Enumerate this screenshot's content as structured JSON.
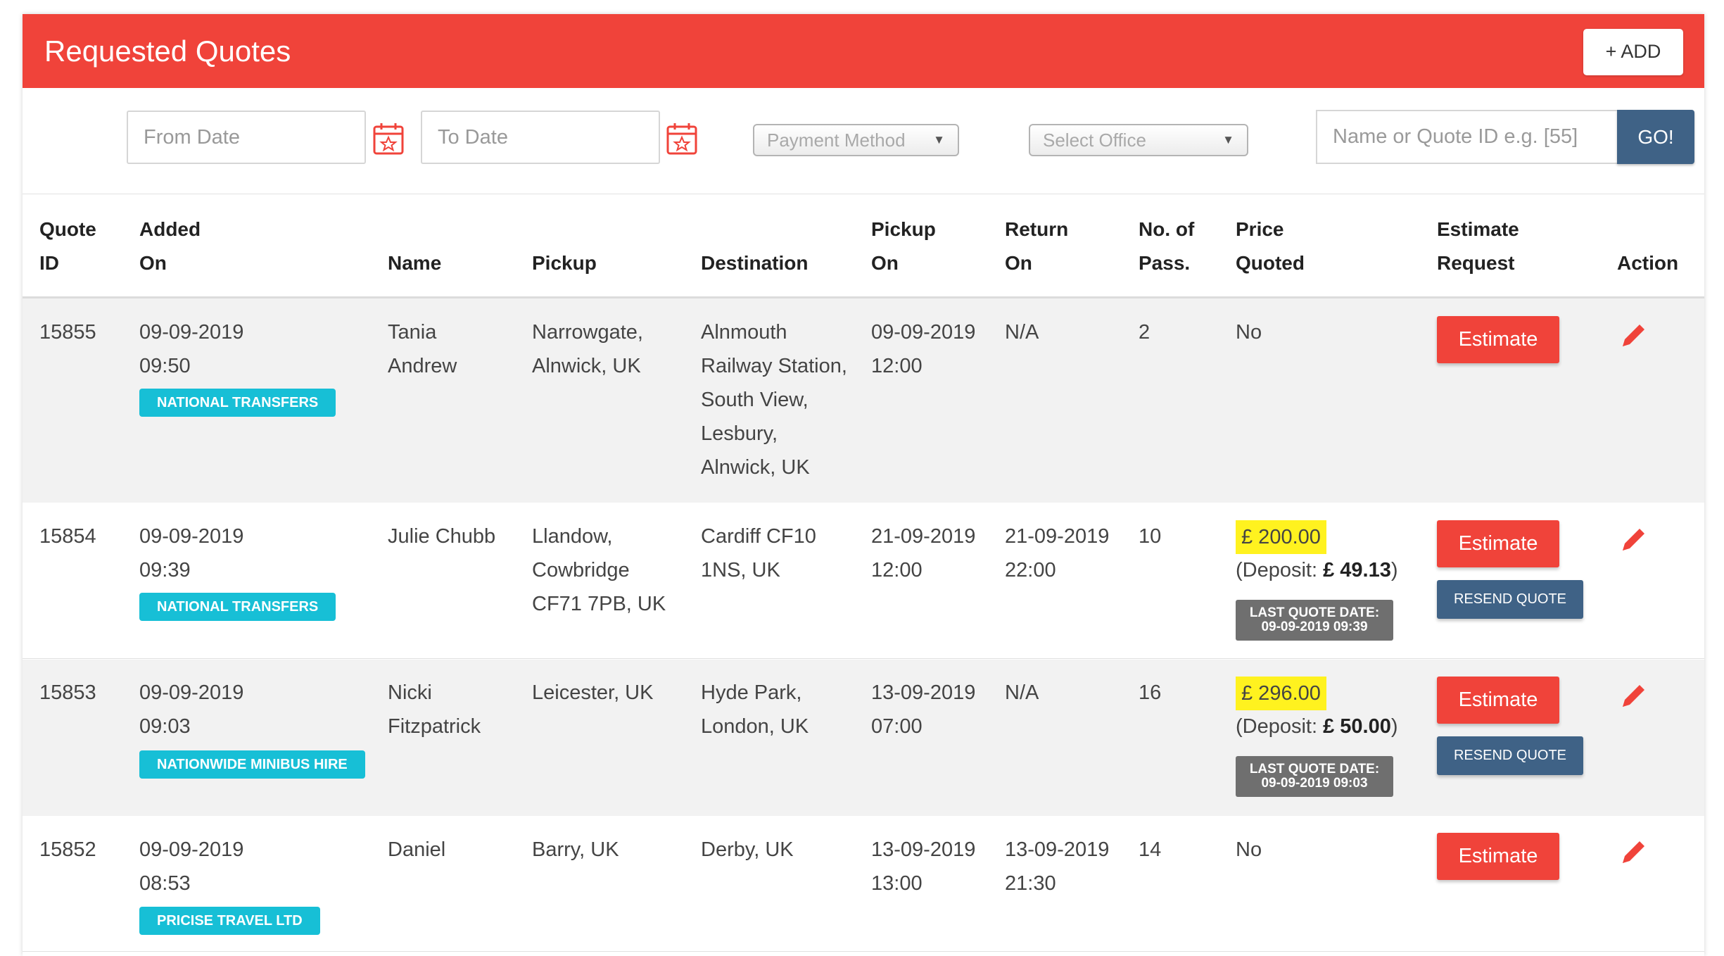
{
  "header": {
    "title": "Requested Quotes",
    "add_label": "+ ADD"
  },
  "filters": {
    "from_date_placeholder": "From Date",
    "to_date_placeholder": "To Date",
    "payment_method": "Payment Method",
    "office": "Select Office",
    "search_placeholder": "Name or Quote ID e.g. [55]",
    "go_label": "GO!"
  },
  "table": {
    "headers": {
      "quote_id": [
        "Quote",
        "ID"
      ],
      "added_on": [
        "Added",
        "On"
      ],
      "name": "Name",
      "pickup": "Pickup",
      "destination": "Destination",
      "pickup_on": [
        "Pickup",
        "On"
      ],
      "return_on": [
        "Return",
        "On"
      ],
      "passengers": [
        "No. of",
        "Pass."
      ],
      "price_quoted": [
        "Price",
        "Quoted"
      ],
      "estimate_request": [
        "Estimate",
        "Request"
      ],
      "action": "Action"
    },
    "rows": [
      {
        "id": "15855",
        "added": [
          "09-09-2019",
          "09:50"
        ],
        "tag": "NATIONAL TRANSFERS",
        "name": [
          "Tania",
          "Andrew"
        ],
        "pickup": [
          "Narrowgate,",
          "Alnwick, UK"
        ],
        "destination": [
          "Alnmouth",
          "Railway Station,",
          "South View,",
          "Lesbury,",
          "Alnwick, UK"
        ],
        "pickup_on": [
          "09-09-2019",
          "12:00"
        ],
        "return_on": [
          "N/A"
        ],
        "passengers": "2",
        "price": "No",
        "estimate_label": "Estimate"
      },
      {
        "id": "15854",
        "added": [
          "09-09-2019",
          "09:39"
        ],
        "tag": "NATIONAL TRANSFERS",
        "name": [
          "Julie Chubb"
        ],
        "pickup": [
          "Llandow,",
          "Cowbridge",
          "CF71 7PB, UK"
        ],
        "destination": [
          "Cardiff CF10",
          "1NS, UK"
        ],
        "pickup_on": [
          "21-09-2019",
          "12:00"
        ],
        "return_on": [
          "21-09-2019",
          "22:00"
        ],
        "passengers": "10",
        "price": "£ 200.00",
        "deposit_prefix": "(Deposit: ",
        "deposit_value": "£ 49.13",
        "deposit_suffix": ")",
        "last_quote_label": "LAST QUOTE DATE:",
        "last_quote_date": "09-09-2019 09:39",
        "estimate_label": "Estimate",
        "resend_label": "RESEND QUOTE"
      },
      {
        "id": "15853",
        "added": [
          "09-09-2019",
          "09:03"
        ],
        "tag": "NATIONWIDE MINIBUS HIRE",
        "name": [
          "Nicki",
          "Fitzpatrick"
        ],
        "pickup": [
          "Leicester, UK"
        ],
        "destination": [
          "Hyde Park,",
          "London, UK"
        ],
        "pickup_on": [
          "13-09-2019",
          "07:00"
        ],
        "return_on": [
          "N/A"
        ],
        "passengers": "16",
        "price": "£ 296.00",
        "deposit_prefix": "(Deposit: ",
        "deposit_value": "£ 50.00",
        "deposit_suffix": ")",
        "last_quote_label": "LAST QUOTE DATE:",
        "last_quote_date": "09-09-2019 09:03",
        "estimate_label": "Estimate",
        "resend_label": "RESEND QUOTE"
      },
      {
        "id": "15852",
        "added": [
          "09-09-2019",
          "08:53"
        ],
        "tag": "PRICISE TRAVEL LTD",
        "name": [
          "Daniel"
        ],
        "pickup": [
          "Barry, UK"
        ],
        "destination": [
          "Derby, UK"
        ],
        "pickup_on": [
          "13-09-2019",
          "13:00"
        ],
        "return_on": [
          "13-09-2019",
          "21:30"
        ],
        "passengers": "14",
        "price": "No",
        "estimate_label": "Estimate"
      }
    ]
  },
  "colors": {
    "brand_red": "#f0433a",
    "navy": "#3f6286",
    "tag_cyan": "#17bfd6",
    "price_highlight": "#fff21f"
  },
  "icons": {
    "calendar": "calendar-icon",
    "edit": "pencil-icon"
  }
}
